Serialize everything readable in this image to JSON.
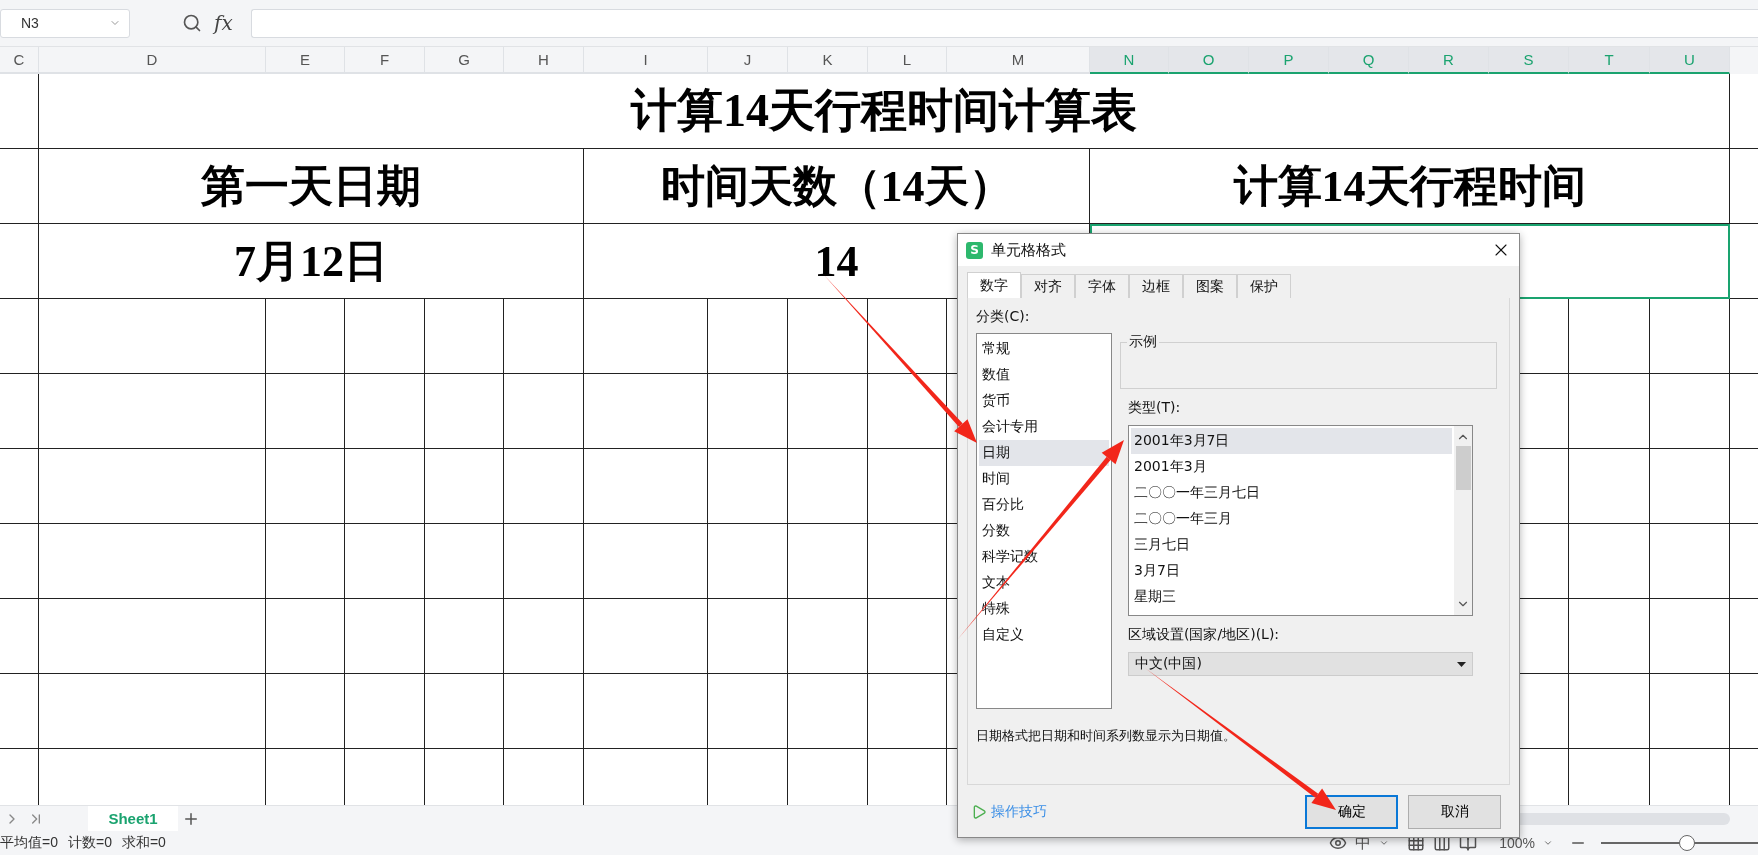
{
  "formula_bar": {
    "name_box": "N3",
    "function_label": "fx"
  },
  "column_headers": [
    {
      "label": "C",
      "selected": false
    },
    {
      "label": "D",
      "selected": false
    },
    {
      "label": "E",
      "selected": false
    },
    {
      "label": "F",
      "selected": false
    },
    {
      "label": "G",
      "selected": false
    },
    {
      "label": "H",
      "selected": false
    },
    {
      "label": "I",
      "selected": false
    },
    {
      "label": "J",
      "selected": false
    },
    {
      "label": "K",
      "selected": false
    },
    {
      "label": "L",
      "selected": false
    },
    {
      "label": "M",
      "selected": false
    },
    {
      "label": "N",
      "selected": true
    },
    {
      "label": "O",
      "selected": true
    },
    {
      "label": "P",
      "selected": true
    },
    {
      "label": "Q",
      "selected": true
    },
    {
      "label": "R",
      "selected": true
    },
    {
      "label": "S",
      "selected": true
    },
    {
      "label": "T",
      "selected": true
    },
    {
      "label": "U",
      "selected": true
    }
  ],
  "sheet": {
    "title": "计算14天行程时间计算表",
    "header_row": [
      {
        "text": "第一天日期"
      },
      {
        "text": "时间天数（14天）"
      },
      {
        "text": "计算14天行程时间"
      }
    ],
    "value_row": [
      {
        "text": "7月12日",
        "selected": false
      },
      {
        "text": "14",
        "selected": false
      },
      {
        "selected": true
      }
    ]
  },
  "dialog": {
    "app_icon_letter": "S",
    "title": "单元格格式",
    "tabs": [
      {
        "label": "数字",
        "selected": true
      },
      {
        "label": "对齐",
        "selected": false
      },
      {
        "label": "字体",
        "selected": false
      },
      {
        "label": "边框",
        "selected": false
      },
      {
        "label": "图案",
        "selected": false
      },
      {
        "label": "保护",
        "selected": false
      }
    ],
    "category_label": "分类(C):",
    "categories": [
      {
        "label": "常规",
        "selected": false
      },
      {
        "label": "数值",
        "selected": false
      },
      {
        "label": "货币",
        "selected": false
      },
      {
        "label": "会计专用",
        "selected": false
      },
      {
        "label": "日期",
        "selected": true
      },
      {
        "label": "时间",
        "selected": false
      },
      {
        "label": "百分比",
        "selected": false
      },
      {
        "label": "分数",
        "selected": false
      },
      {
        "label": "科学记数",
        "selected": false
      },
      {
        "label": "文本",
        "selected": false
      },
      {
        "label": "特殊",
        "selected": false
      },
      {
        "label": "自定义",
        "selected": false
      }
    ],
    "sample_label": "示例",
    "type_label": "类型(T):",
    "types": [
      {
        "label": "2001年3月7日",
        "selected": true
      },
      {
        "label": "2001年3月",
        "selected": false
      },
      {
        "label": "二〇〇一年三月七日",
        "selected": false
      },
      {
        "label": "二〇〇一年三月",
        "selected": false
      },
      {
        "label": "三月七日",
        "selected": false
      },
      {
        "label": "3月7日",
        "selected": false
      },
      {
        "label": "星期三",
        "selected": false
      }
    ],
    "locale_label": "区域设置(国家/地区)(L):",
    "locale_value": "中文(中国)",
    "description": "日期格式把日期和时间系列数显示为日期值。",
    "tips_link": "操作技巧",
    "buttons": [
      {
        "label": "确定",
        "kind": "primary"
      },
      {
        "label": "取消",
        "kind": "secondary"
      }
    ]
  },
  "sheet_tabs": [
    {
      "label": "Sheet1",
      "selected": true
    }
  ],
  "status_bar": {
    "stats": [
      "平均值=0",
      "计数=0",
      "求和=0"
    ],
    "input_mode": "中",
    "zoom": "100%",
    "zoom_slider": {
      "level": 0.55
    }
  }
}
